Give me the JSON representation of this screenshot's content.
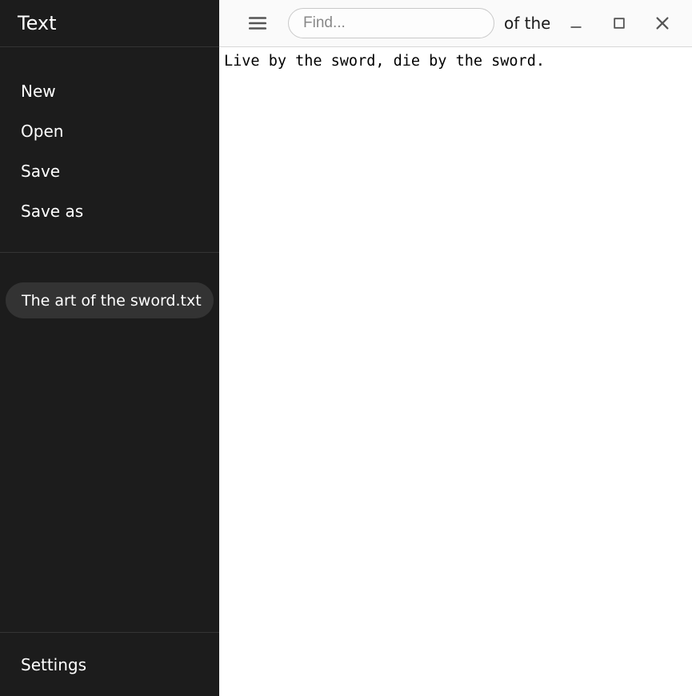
{
  "sidebar": {
    "title": "Text",
    "menu": {
      "new": "New",
      "open": "Open",
      "save": "Save",
      "save_as": "Save as"
    },
    "files": [
      {
        "name": "The art of the sword.txt"
      }
    ],
    "settings": "Settings"
  },
  "header": {
    "title_visible_fragment": " of the sw",
    "find_placeholder": "Find..."
  },
  "editor": {
    "content": "Live by the sword, die by the sword."
  }
}
